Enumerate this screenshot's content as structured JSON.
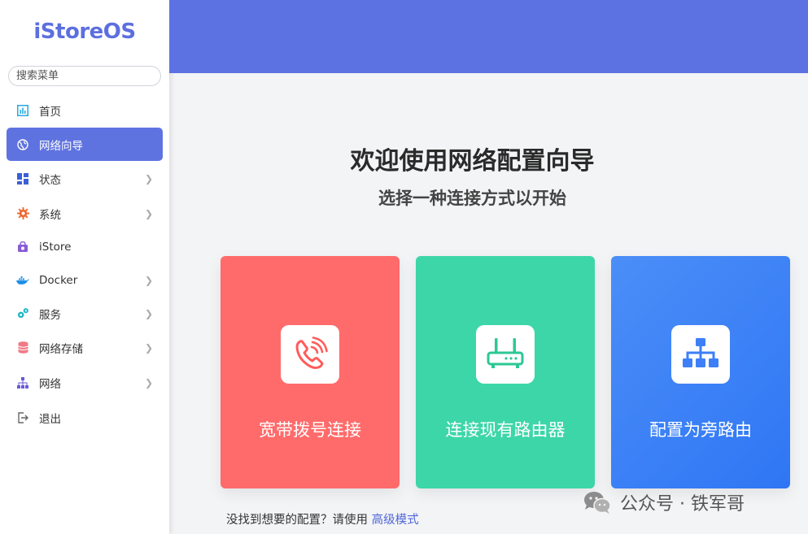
{
  "app": {
    "logo": "iStoreOS"
  },
  "sidebar": {
    "search_placeholder": "搜索菜单",
    "items": [
      {
        "label": "首页",
        "icon": "dashboard-icon",
        "chevron": false,
        "active": false
      },
      {
        "label": "网络向导",
        "icon": "globe-icon",
        "chevron": false,
        "active": true
      },
      {
        "label": "状态",
        "icon": "grid-icon",
        "chevron": true,
        "active": false
      },
      {
        "label": "系统",
        "icon": "gear-icon",
        "chevron": true,
        "active": false
      },
      {
        "label": "iStore",
        "icon": "store-icon",
        "chevron": false,
        "active": false
      },
      {
        "label": "Docker",
        "icon": "docker-icon",
        "chevron": true,
        "active": false
      },
      {
        "label": "服务",
        "icon": "services-icon",
        "chevron": true,
        "active": false
      },
      {
        "label": "网络存储",
        "icon": "database-icon",
        "chevron": true,
        "active": false
      },
      {
        "label": "网络",
        "icon": "network-icon",
        "chevron": true,
        "active": false
      },
      {
        "label": "退出",
        "icon": "logout-icon",
        "chevron": false,
        "active": false
      }
    ]
  },
  "main": {
    "title": "欢迎使用网络配置向导",
    "subtitle": "选择一种连接方式以开始",
    "cards": [
      {
        "label": "宽带拨号连接",
        "icon": "phone-icon",
        "color": "#ff6b6b"
      },
      {
        "label": "连接现有路由器",
        "icon": "router-icon",
        "color": "#3dd6a8"
      },
      {
        "label": "配置为旁路由",
        "icon": "sitemap-icon",
        "color": "#3d7ff8"
      }
    ],
    "footer_text": "没找到想要的配置？请使用",
    "footer_link": "高级模式"
  },
  "watermark": {
    "text": "公众号 · 铁军哥"
  },
  "colors": {
    "accent": "#5f73e0",
    "topbar": "#5d72e2",
    "link": "#4e66d8"
  }
}
